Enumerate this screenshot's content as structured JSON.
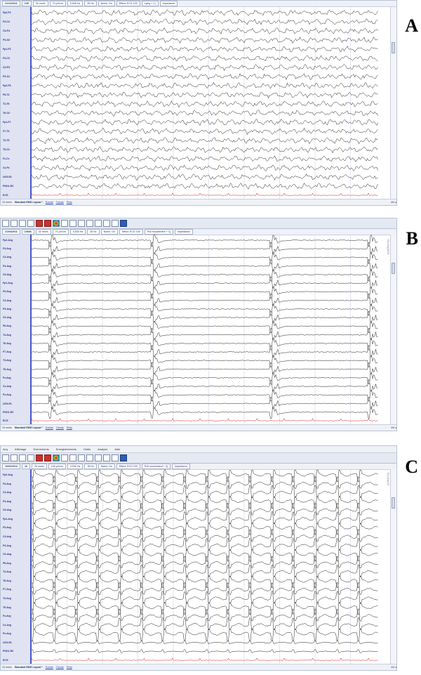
{
  "panels": [
    {
      "id": "A",
      "letter": "A",
      "toolbar": [
        "21/12/2011 ",
        "135",
        "30 mm/s",
        "70 μV/cm",
        "0,530 Hz",
        "35 Hz",
        "Notch: On",
        "Effect: ECG 100",
        "Lying + Cj",
        "Impedance"
      ],
      "channels": [
        "Fp2-F4",
        "F4-C4",
        "C4-P4",
        "P4-O2",
        "Fp1-F3",
        "F3-C3",
        "C3-P3",
        "P3-O1",
        "Fp2-F8",
        "F8-T4",
        "T4-T6",
        "T6-O2",
        "Fp1-F7",
        "F7-T3",
        "T3-T5",
        "T5-O1",
        "Fz-Cz",
        "Cz-Pz",
        "LEG-R1",
        "PNO1-R2",
        "ECG"
      ],
      "status": {
        "left": "10 mm/s",
        "montage": "Standard EMG Layout *",
        "tabs": [
          "Events",
          "Trends",
          "Plots"
        ],
        "nav": "4/4 ◂"
      },
      "ecg_color": "#d02020"
    },
    {
      "id": "B",
      "letter": "B",
      "toolbar": [
        "21/04/2011 ",
        "10606",
        "30 mm/s",
        "70 μV/cm",
        "0,530 Hz",
        "35 Hz",
        "Notch: On",
        "Effect: ECG 100",
        "Poll mouvement + Cj",
        "Impedance"
      ],
      "channels": [
        "Fp2-Avg",
        "F4-Avg",
        "C4-Avg",
        "P4-Avg",
        "O2-Avg",
        "Fp1-Avg",
        "F3-Avg",
        "C3-Avg",
        "P3-Avg",
        "O1-Avg",
        "F8-Avg",
        "T4-Avg",
        "T6-Avg",
        "F7-Avg",
        "T3-Avg",
        "T5-Avg",
        "Fz-Avg",
        "Cz-Avg",
        "Pz-Avg",
        "LEG-R1",
        "PNO1-R2",
        "ECG"
      ],
      "status": {
        "left": "10 mm/s",
        "montage": "Standard EMG Layout *",
        "tabs": [
          "Events",
          "Trends",
          "Plots"
        ],
        "nav": "4/4 ◂"
      },
      "side_label": "Fp1 Avg ECG",
      "ecg_color": "#d02020"
    },
    {
      "id": "C",
      "letter": "C",
      "menu": [
        "Acq",
        "Affichage",
        "Evénements",
        "Enregistrements",
        "Outils",
        "Analyse",
        "Aide"
      ],
      "toolbar": [
        "10/02/2012 ",
        "16",
        "30 mm/s",
        "100 μV/cm",
        "0,530 Hz",
        "35 Hz",
        "Notch: On",
        "Effect: ECG 100",
        "Poll mouvement + Cj",
        "Impedance"
      ],
      "channels": [
        "Fp2-Avg",
        "F4-Avg",
        "C4-Avg",
        "P4-Avg",
        "O2-Avg",
        "Fp1-Avg",
        "F3-Avg",
        "C3-Avg",
        "P3-Avg",
        "O1-Avg",
        "F8-Avg",
        "T4-Avg",
        "T6-Avg",
        "F7-Avg",
        "T3-Avg",
        "T5-Avg",
        "Fz-Avg",
        "Cz-Avg",
        "Pz-Avg",
        "LEG-R1",
        "PNO1-R2",
        "ECG"
      ],
      "status": {
        "left": "10 mm/s",
        "montage": "Standard EMG Layout *",
        "tabs": [
          "Events",
          "Trends",
          "Plots"
        ],
        "nav": "4/4 ◂"
      },
      "side_label": "Fp1 Avg C3",
      "ecg_color": "#d02020"
    }
  ],
  "icons": [
    "montage-icon",
    "grid-icon",
    "filter-icon",
    "wave-icon",
    "video-icon",
    "marker-icon",
    "brain-map-icon",
    "spectrum-icon",
    "split-icon",
    "bars-icon",
    "cursor-icon",
    "zoom-icon",
    "ruler-icon",
    "note-icon",
    "print-icon"
  ]
}
